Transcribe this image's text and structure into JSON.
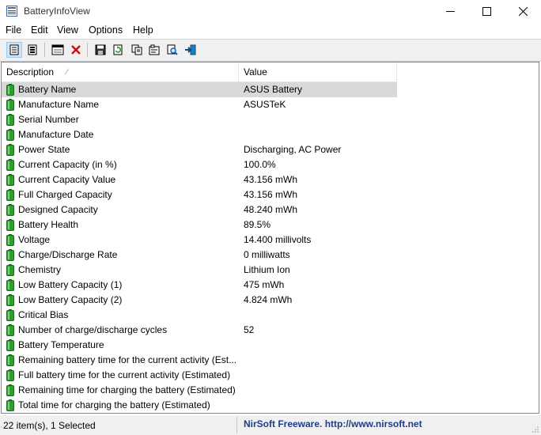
{
  "window": {
    "title": "BatteryInfoView"
  },
  "menu": [
    {
      "label": "File"
    },
    {
      "label": "Edit"
    },
    {
      "label": "View"
    },
    {
      "label": "Options"
    },
    {
      "label": "Help"
    }
  ],
  "toolbar": {
    "buttons": [
      {
        "icon": "general-mode-icon",
        "active": true
      },
      {
        "icon": "log-mode-icon"
      },
      {
        "icon": "battery-window-icon"
      },
      {
        "icon": "delete-icon"
      },
      {
        "icon": "save-icon"
      },
      {
        "icon": "refresh-icon"
      },
      {
        "icon": "copy-icon"
      },
      {
        "icon": "properties-icon"
      },
      {
        "icon": "find-icon"
      },
      {
        "icon": "exit-icon"
      }
    ]
  },
  "list": {
    "columns": [
      {
        "label": "Description"
      },
      {
        "label": "Value"
      }
    ],
    "rows": [
      {
        "description": "Battery Name",
        "value": "ASUS Battery"
      },
      {
        "description": "Manufacture Name",
        "value": "ASUSTeK"
      },
      {
        "description": "Serial Number",
        "value": ""
      },
      {
        "description": "Manufacture Date",
        "value": ""
      },
      {
        "description": "Power State",
        "value": "Discharging, AC Power"
      },
      {
        "description": "Current Capacity (in %)",
        "value": "100.0%"
      },
      {
        "description": "Current Capacity Value",
        "value": "43.156 mWh"
      },
      {
        "description": "Full Charged Capacity",
        "value": "43.156 mWh"
      },
      {
        "description": "Designed Capacity",
        "value": "48.240 mWh"
      },
      {
        "description": "Battery Health",
        "value": "89.5%"
      },
      {
        "description": "Voltage",
        "value": "14.400 millivolts"
      },
      {
        "description": "Charge/Discharge Rate",
        "value": "0 milliwatts"
      },
      {
        "description": "Chemistry",
        "value": "Lithium Ion"
      },
      {
        "description": "Low Battery Capacity (1)",
        "value": "475 mWh"
      },
      {
        "description": "Low Battery Capacity (2)",
        "value": "4.824 mWh"
      },
      {
        "description": "Critical Bias",
        "value": ""
      },
      {
        "description": "Number of charge/discharge cycles",
        "value": "52"
      },
      {
        "description": "Battery Temperature",
        "value": ""
      },
      {
        "description": "Remaining battery time for the current activity (Est...",
        "value": ""
      },
      {
        "description": "Full battery time for the current activity (Estimated)",
        "value": ""
      },
      {
        "description": "Remaining time for charging the battery (Estimated)",
        "value": ""
      },
      {
        "description": "Total  time for charging the battery (Estimated)",
        "value": ""
      }
    ],
    "selected_index": 0
  },
  "status": {
    "count_text": "22 item(s), 1 Selected",
    "credit_text": "NirSoft Freeware.  http://www.nirsoft.net"
  },
  "colors": {
    "battery_green": "#2e9e2e",
    "credit_blue": "#1f3c88"
  }
}
